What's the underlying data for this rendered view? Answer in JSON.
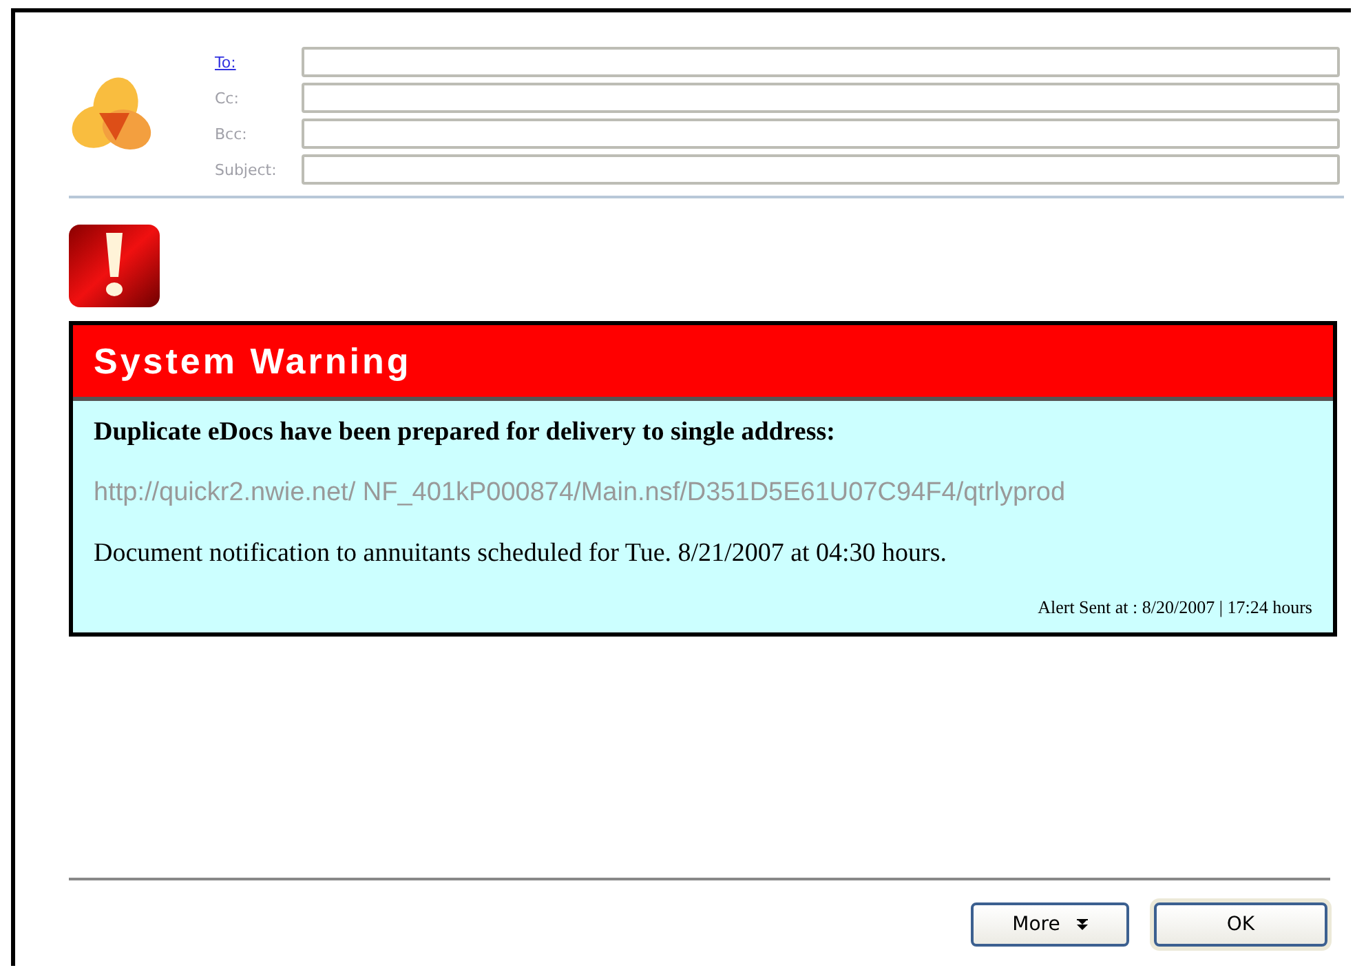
{
  "header_fields": [
    {
      "label": "To:",
      "kind": "link"
    },
    {
      "label": "Cc:",
      "kind": "plain"
    },
    {
      "label": "Bcc:",
      "kind": "plain"
    },
    {
      "label": "Subject:",
      "kind": "plain"
    }
  ],
  "alert": {
    "title": "System Warning",
    "heading": "Duplicate eDocs have been prepared for delivery to single address:",
    "url": "http://quickr2.nwie.net/ NF_401kP000874/Main.nsf/D351D5E61U07C94F4/qtrlyprod",
    "message": "Document notification to annuitants scheduled for Tue. 8/21/2007 at 04:30 hours.",
    "footer": "Alert Sent at : 8/20/2007 | 17:24 hours"
  },
  "buttons": [
    {
      "label": "More",
      "kind": "menu"
    },
    {
      "label": "OK",
      "kind": "default"
    }
  ]
}
